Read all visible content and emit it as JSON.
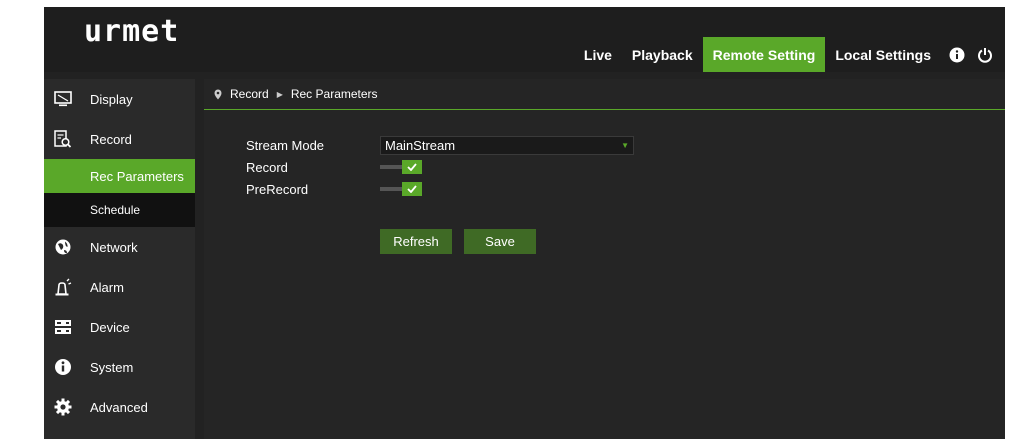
{
  "brand": {
    "logo_text": "urmet"
  },
  "topnav": {
    "items": [
      {
        "label": "Live",
        "active": false
      },
      {
        "label": "Playback",
        "active": false
      },
      {
        "label": "Remote Setting",
        "active": true
      },
      {
        "label": "Local Settings",
        "active": false
      }
    ],
    "icons": [
      "info-icon",
      "power-icon"
    ]
  },
  "sidebar": {
    "items": [
      {
        "label": "Display",
        "icon": "monitor-icon"
      },
      {
        "label": "Record",
        "icon": "record-icon"
      },
      {
        "label": "Network",
        "icon": "network-icon"
      },
      {
        "label": "Alarm",
        "icon": "alarm-icon"
      },
      {
        "label": "Device",
        "icon": "device-icon"
      },
      {
        "label": "System",
        "icon": "info-icon"
      },
      {
        "label": "Advanced",
        "icon": "gear-icon"
      }
    ],
    "record_subitems": [
      {
        "label": "Rec Parameters",
        "active": true
      },
      {
        "label": "Schedule",
        "active": false
      }
    ]
  },
  "breadcrumb": {
    "parent": "Record",
    "current": "Rec Parameters"
  },
  "form": {
    "stream_mode": {
      "label": "Stream Mode",
      "value": "MainStream"
    },
    "record": {
      "label": "Record",
      "checked": true
    },
    "prerecord": {
      "label": "PreRecord",
      "checked": true
    }
  },
  "buttons": {
    "refresh": "Refresh",
    "save": "Save"
  },
  "colors": {
    "accent": "#5aa829",
    "button": "#3f6a25",
    "background": "#222222"
  }
}
